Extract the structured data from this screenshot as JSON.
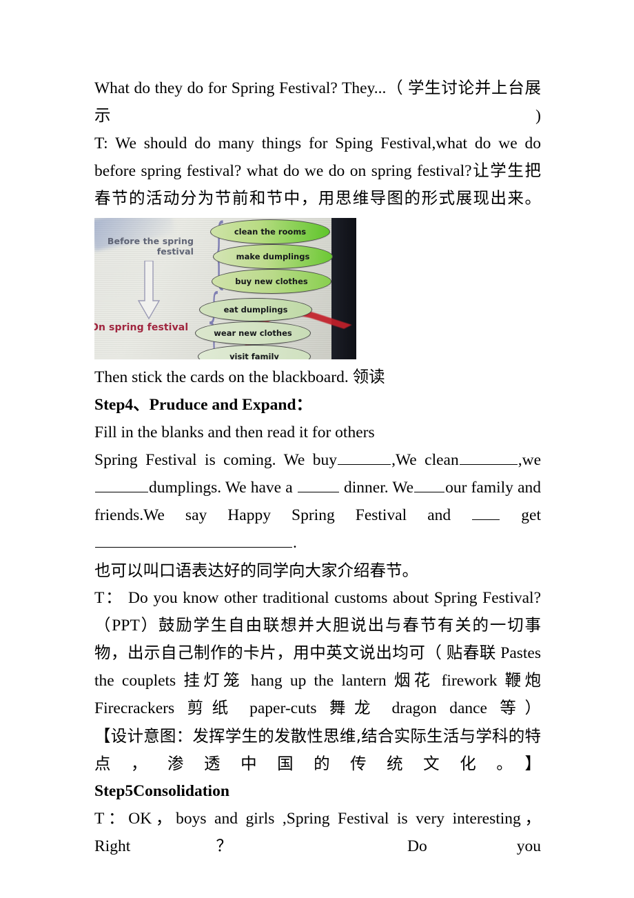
{
  "document": {
    "paragraphs": [
      {
        "id": "p1",
        "text": "What do they do for Spring Festival? They...（ 学生讨论并上台展示)"
      },
      {
        "id": "p2",
        "text": "T: We should do many things for Sping Festival,what do we do before spring festival? what do we do on spring festival?让学生把春节的活动分为节前和节中，用思维导图的形式展现出来。"
      },
      {
        "id": "p3",
        "text": "Then stick the cards on the blackboard.  领读"
      },
      {
        "id": "p4_heading",
        "text": "Step4、Pruduce and Expand："
      },
      {
        "id": "p5",
        "text": "Fill in the blanks and then read it for others"
      },
      {
        "id": "p7",
        "text": "也可以叫口语表达好的同学向大家介绍春节。"
      },
      {
        "id": "p8",
        "text": "T：  Do you know other traditional customs about Spring Festival?（PPT）鼓励学生自由联想并大胆说出与春节有关的一切事物，出示自己制作的卡片，用中英文说出均可（ 贴春联 Pastes the couplets 挂灯笼 hang up the lantern 烟花 firework  鞭炮 Firecrackers  剪纸  paper-cuts 舞龙 dragon dance 等）"
      },
      {
        "id": "p9",
        "text": "【设计意图：发挥学生的发散性思维,结合实际生活与学科的特点，渗透中国的传统文化。】"
      },
      {
        "id": "p10_heading",
        "text": "Step5Consolidation"
      },
      {
        "id": "p11",
        "text": "T：OK，boys and girls ,Spring Festival is very interesting，Right？ Do you"
      }
    ],
    "fill_in_exercise": {
      "seg1": "Spring  Festival  is  coming.  We  buy",
      "seg2": ",We   clean",
      "seg3": ",we",
      "seg4": "dumplings.  We  have  a",
      "seg5": "dinner.  We",
      "seg6": "our  family  and",
      "seg7": "friends.We     say     Happy     Spring     Festival     and",
      "seg8": "get",
      "seg9": "."
    }
  },
  "photo": {
    "alt_name": "mind-map-photo",
    "left_labels": {
      "before": "Before the  spring festival",
      "before_line1": "Before the  spring",
      "before_line2": "festival",
      "on": "On spring festival"
    },
    "branch_before": [
      "clean the rooms",
      "make dumplings",
      "buy new clothes"
    ],
    "branch_on": [
      "eat dumplings",
      "wear new clothes",
      "visit family"
    ],
    "colors": {
      "before_label": "#5f6475",
      "on_label": "#a0263f",
      "bubble_green": "#5ec52a",
      "bubble_pale": "#cfe0bf",
      "brace": "#7f7fb2",
      "dark_strip": "#14161d",
      "red_ribbon": "#c3202a"
    }
  }
}
